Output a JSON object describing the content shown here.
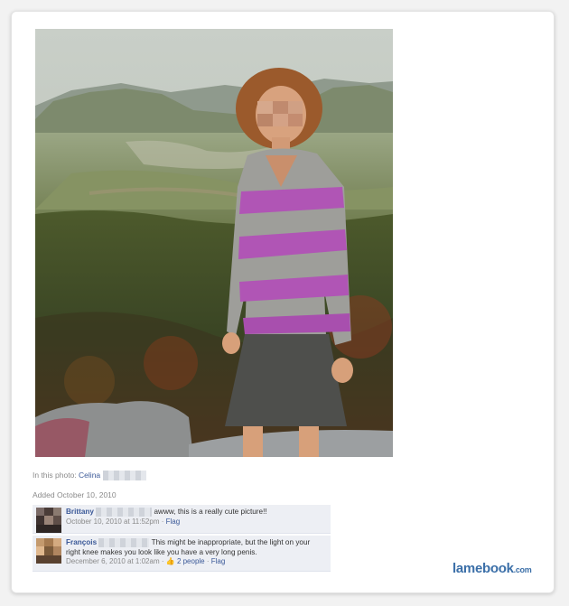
{
  "photo_caption": {
    "label": "In this photo:",
    "person": "Celina"
  },
  "added": "Added October 10, 2010",
  "comments": [
    {
      "author": "Brittany",
      "text": "awww, this is a really cute picture!!",
      "timestamp": "October 10, 2010 at 11:52pm",
      "flag": "Flag"
    },
    {
      "author": "François",
      "text": "This might be inappropriate, but the light on your right knee makes you look like you have a very long penis.",
      "timestamp": "December 6, 2010 at 1:02am",
      "likes": "2 people",
      "flag": "Flag"
    }
  ],
  "watermark": {
    "name": "lamebook",
    "domain": ".com"
  },
  "colors": {
    "link": "#3b5998",
    "comment_bg": "#edeff4",
    "muted": "#8a8a8a"
  }
}
